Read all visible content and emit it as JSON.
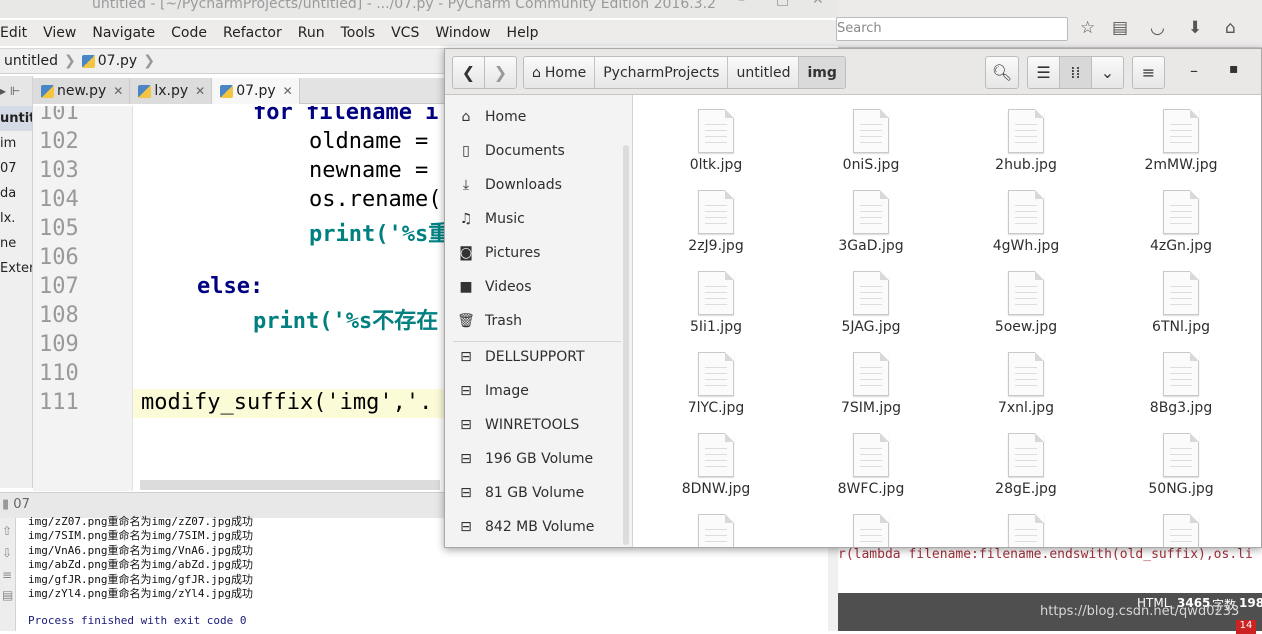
{
  "pycharm": {
    "title": "untitled - [~/PycharmProjects/untitled] - .../07.py - PyCharm Community Edition 2016.3.2",
    "menu": [
      "Edit",
      "View",
      "Navigate",
      "Code",
      "Refactor",
      "Run",
      "Tools",
      "VCS",
      "Window",
      "Help"
    ],
    "breadcrumb": {
      "project": "untitled",
      "file": "07.py"
    },
    "project_items": [
      "untit",
      "im",
      "07",
      "da",
      "lx.",
      "ne",
      "Exter"
    ],
    "tabs": [
      {
        "label": "new.py",
        "active": false
      },
      {
        "label": "lx.py",
        "active": false
      },
      {
        "label": "07.py",
        "active": true
      }
    ],
    "code_lines": [
      {
        "num": "101",
        "text": "for filename i"
      },
      {
        "num": "102",
        "text": "oldname ="
      },
      {
        "num": "103",
        "text": "newname ="
      },
      {
        "num": "104",
        "text": "os.rename("
      },
      {
        "num": "105",
        "text": "print('%s重"
      },
      {
        "num": "106",
        "text": ""
      },
      {
        "num": "107",
        "text": "else:"
      },
      {
        "num": "108",
        "text": "print('%s不存在"
      },
      {
        "num": "109",
        "text": ""
      },
      {
        "num": "110",
        "text": ""
      },
      {
        "num": "111",
        "text": "modify_suffix('img','."
      }
    ],
    "run_tab": "07",
    "output": [
      "img/zZ07.png重命名为img/zZ07.jpg成功",
      "img/7SIM.png重命名为img/7SIM.jpg成功",
      "img/VnA6.png重命名为img/VnA6.jpg成功",
      "img/abZd.png重命名为img/abZd.jpg成功",
      "img/gfJR.png重命名为img/gfJR.jpg成功",
      "img/zYl4.png重命名为img/zYl4.jpg成功",
      "",
      "Process finished with exit code 0"
    ]
  },
  "browser": {
    "search_placeholder": "Search",
    "code_snippet": "r(lambda filename:filename.endswith(old_suffix),os.li",
    "status": {
      "mode": "HTML",
      "count": "3465",
      "unit": "字数",
      "extra": "198",
      "watermark": "https://blog.csdn.net/qwd0233",
      "badge": "14"
    }
  },
  "file_manager": {
    "path": [
      "Home",
      "PycharmProjects",
      "untitled",
      "img"
    ],
    "sidebar": [
      {
        "label": "Home",
        "icon": "home-icon"
      },
      {
        "label": "Documents",
        "icon": "document-icon"
      },
      {
        "label": "Downloads",
        "icon": "download-icon"
      },
      {
        "label": "Music",
        "icon": "music-icon"
      },
      {
        "label": "Pictures",
        "icon": "camera-icon"
      },
      {
        "label": "Videos",
        "icon": "video-icon"
      },
      {
        "label": "Trash",
        "icon": "trash-icon"
      },
      {
        "label": "DELLSUPPORT",
        "icon": "drive-icon"
      },
      {
        "label": "Image",
        "icon": "drive-icon"
      },
      {
        "label": "WINRETOOLS",
        "icon": "drive-icon"
      },
      {
        "label": "196 GB Volume",
        "icon": "drive-icon"
      },
      {
        "label": "81 GB Volume",
        "icon": "drive-icon"
      },
      {
        "label": "842 MB Volume",
        "icon": "drive-icon"
      }
    ],
    "files": [
      "0ltk.jpg",
      "0niS.jpg",
      "2hub.jpg",
      "2mMW.jpg",
      "2zJ9.jpg",
      "3GaD.jpg",
      "4gWh.jpg",
      "4zGn.jpg",
      "5Ii1.jpg",
      "5JAG.jpg",
      "5oew.jpg",
      "6TNl.jpg",
      "7lYC.jpg",
      "7SIM.jpg",
      "7xnl.jpg",
      "8Bg3.jpg",
      "8DNW.jpg",
      "8WFC.jpg",
      "28gE.jpg",
      "50NG.jpg",
      "",
      "",
      "",
      ""
    ]
  }
}
